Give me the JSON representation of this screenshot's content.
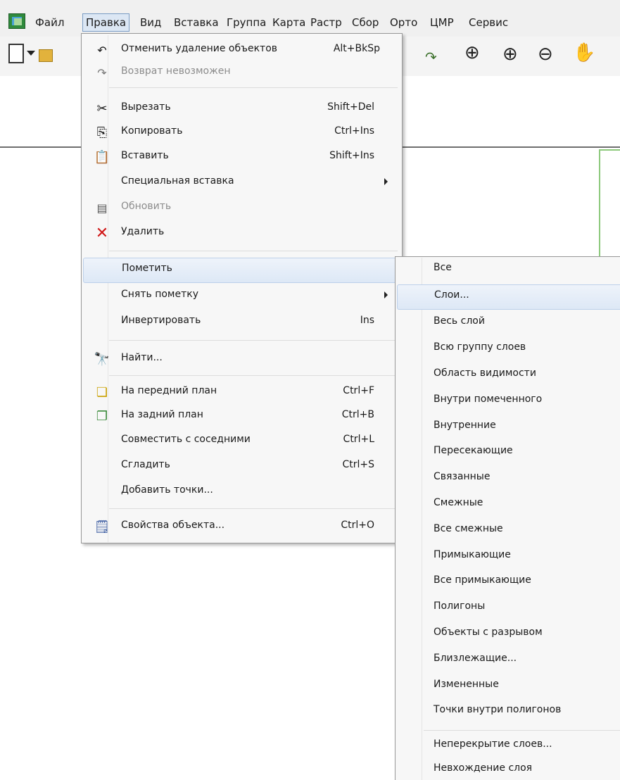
{
  "menubar": {
    "items": [
      "Файл",
      "Правка",
      "Вид",
      "Вставка",
      "Группа",
      "Карта",
      "Растр",
      "Сбор",
      "Орто",
      "ЦМР",
      "Сервис"
    ]
  },
  "edit_menu": {
    "items": [
      {
        "label": "Отменить удаление объектов",
        "shortcut": "Alt+BkSp",
        "icon": "undo-icon",
        "enabled": true
      },
      {
        "label": "Возврат невозможен",
        "shortcut": "",
        "icon": "redo-icon",
        "enabled": false
      },
      {
        "label": "Вырезать",
        "shortcut": "Shift+Del",
        "icon": "scissors-icon",
        "enabled": true
      },
      {
        "label": "Копировать",
        "shortcut": "Ctrl+Ins",
        "icon": "copy-icon",
        "enabled": true
      },
      {
        "label": "Вставить",
        "shortcut": "Shift+Ins",
        "icon": "paste-icon",
        "enabled": true
      },
      {
        "label": "Специальная вставка",
        "shortcut": "",
        "icon": "",
        "enabled": true,
        "submenu": true
      },
      {
        "label": "Обновить",
        "shortcut": "",
        "icon": "refresh-icon",
        "enabled": false
      },
      {
        "label": "Удалить",
        "shortcut": "",
        "icon": "delete-x-icon",
        "enabled": true
      },
      {
        "label": "Пометить",
        "shortcut": "",
        "icon": "",
        "enabled": true,
        "submenu": true,
        "highlighted": true
      },
      {
        "label": "Снять пометку",
        "shortcut": "",
        "icon": "",
        "enabled": true,
        "submenu": true
      },
      {
        "label": "Инвертировать",
        "shortcut": "Ins",
        "icon": "",
        "enabled": true
      },
      {
        "label": "Найти...",
        "shortcut": "",
        "icon": "binoculars-icon",
        "enabled": true
      },
      {
        "label": "На передний план",
        "shortcut": "Ctrl+F",
        "icon": "bring-front-icon",
        "enabled": true
      },
      {
        "label": "На задний план",
        "shortcut": "Ctrl+B",
        "icon": "send-back-icon",
        "enabled": true
      },
      {
        "label": "Совместить с соседними",
        "shortcut": "Ctrl+L",
        "icon": "",
        "enabled": true
      },
      {
        "label": "Сгладить",
        "shortcut": "Ctrl+S",
        "icon": "",
        "enabled": true
      },
      {
        "label": "Добавить точки...",
        "shortcut": "",
        "icon": "",
        "enabled": true
      },
      {
        "label": "Свойства объекта...",
        "shortcut": "Ctrl+O",
        "icon": "properties-icon",
        "enabled": true
      }
    ]
  },
  "mark_submenu": {
    "items": [
      "Все",
      "Слои...",
      "Весь слой",
      "Всю группу слоев",
      "Область видимости",
      "Внутри помеченного",
      "Внутренние",
      "Пересекающие",
      "Связанные",
      "Смежные",
      "Все смежные",
      "Примыкающие",
      "Все примыкающие",
      "Полигоны",
      "Объекты с разрывом",
      "Близлежащие...",
      "Измененные",
      "Точки внутри полигонов",
      "Неперекрытие слоев...",
      "Невхождение слоя"
    ],
    "highlighted_index": 1
  },
  "colors": {
    "accent": "#dde8f6",
    "map_frame": "#8cc97b",
    "delete": "#d01818"
  }
}
